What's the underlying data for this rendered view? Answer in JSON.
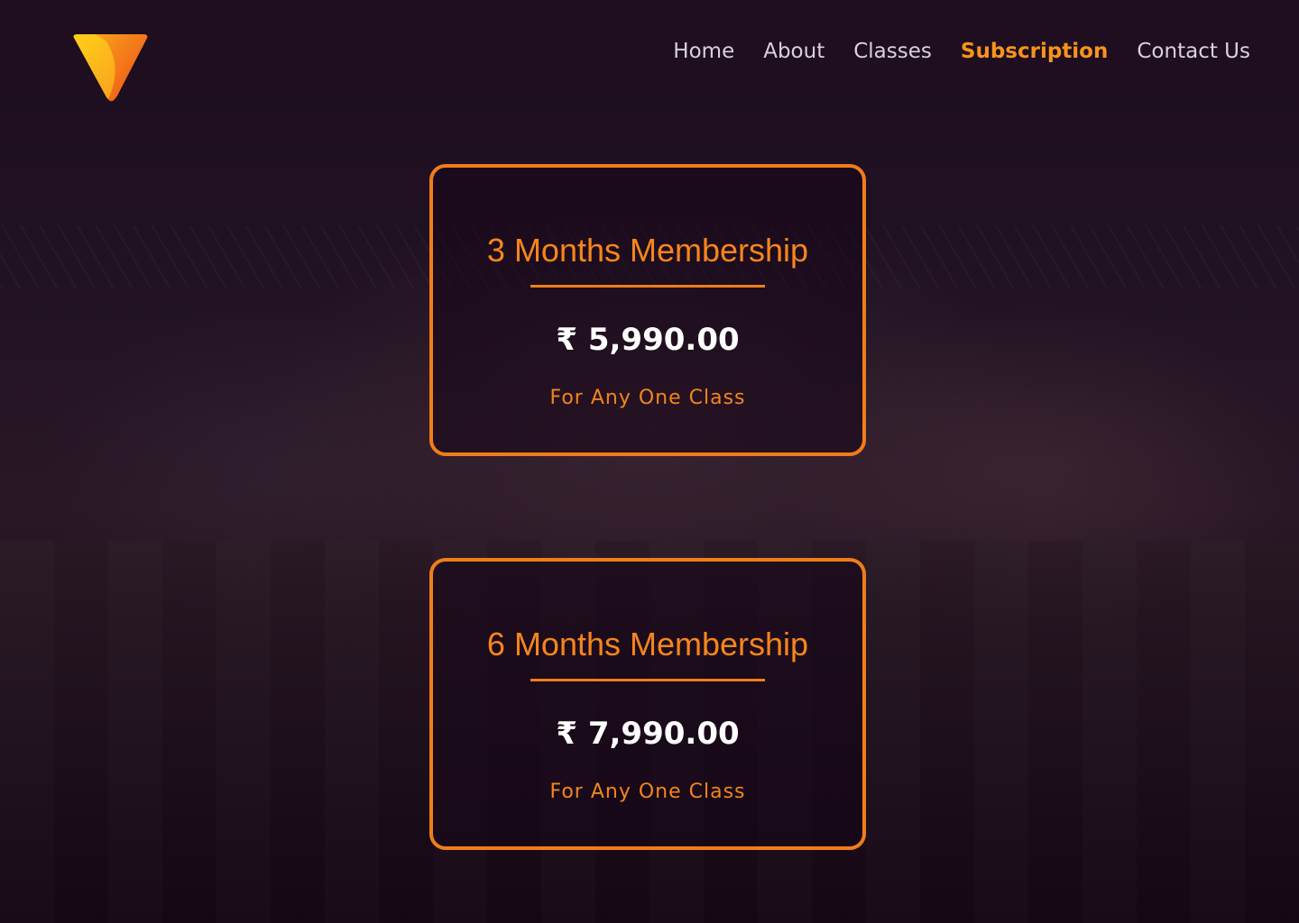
{
  "brand": {
    "logo_icon": "v-shaped-brand-logo",
    "colors": {
      "accent": "#f7931e",
      "logo_light": "#ffc40d",
      "logo_dark": "#f25b13"
    }
  },
  "nav": {
    "items": [
      {
        "label": "Home"
      },
      {
        "label": "About"
      },
      {
        "label": "Classes"
      },
      {
        "label": "Subscription"
      },
      {
        "label": "Contact Us"
      }
    ],
    "active": "Subscription"
  },
  "plans": [
    {
      "title": "3 Months Membership",
      "price": "₹ 5,990.00",
      "note": "For Any One Class"
    },
    {
      "title": "6 Months Membership",
      "price": "₹ 7,990.00",
      "note": "For Any One Class"
    }
  ]
}
